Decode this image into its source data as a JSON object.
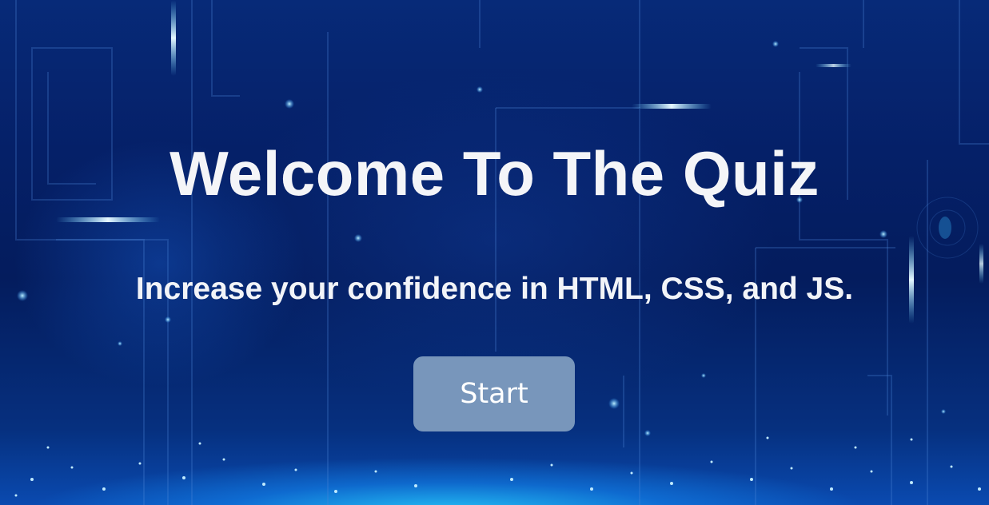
{
  "welcome": {
    "title": "Welcome To The Quiz",
    "subtitle": "Increase your confidence in HTML, CSS, and JS.",
    "start_label": "Start"
  },
  "colors": {
    "background": "#06256e",
    "glow": "#28d2ff",
    "text": "#f4f5f8",
    "button": "#7896bb"
  }
}
